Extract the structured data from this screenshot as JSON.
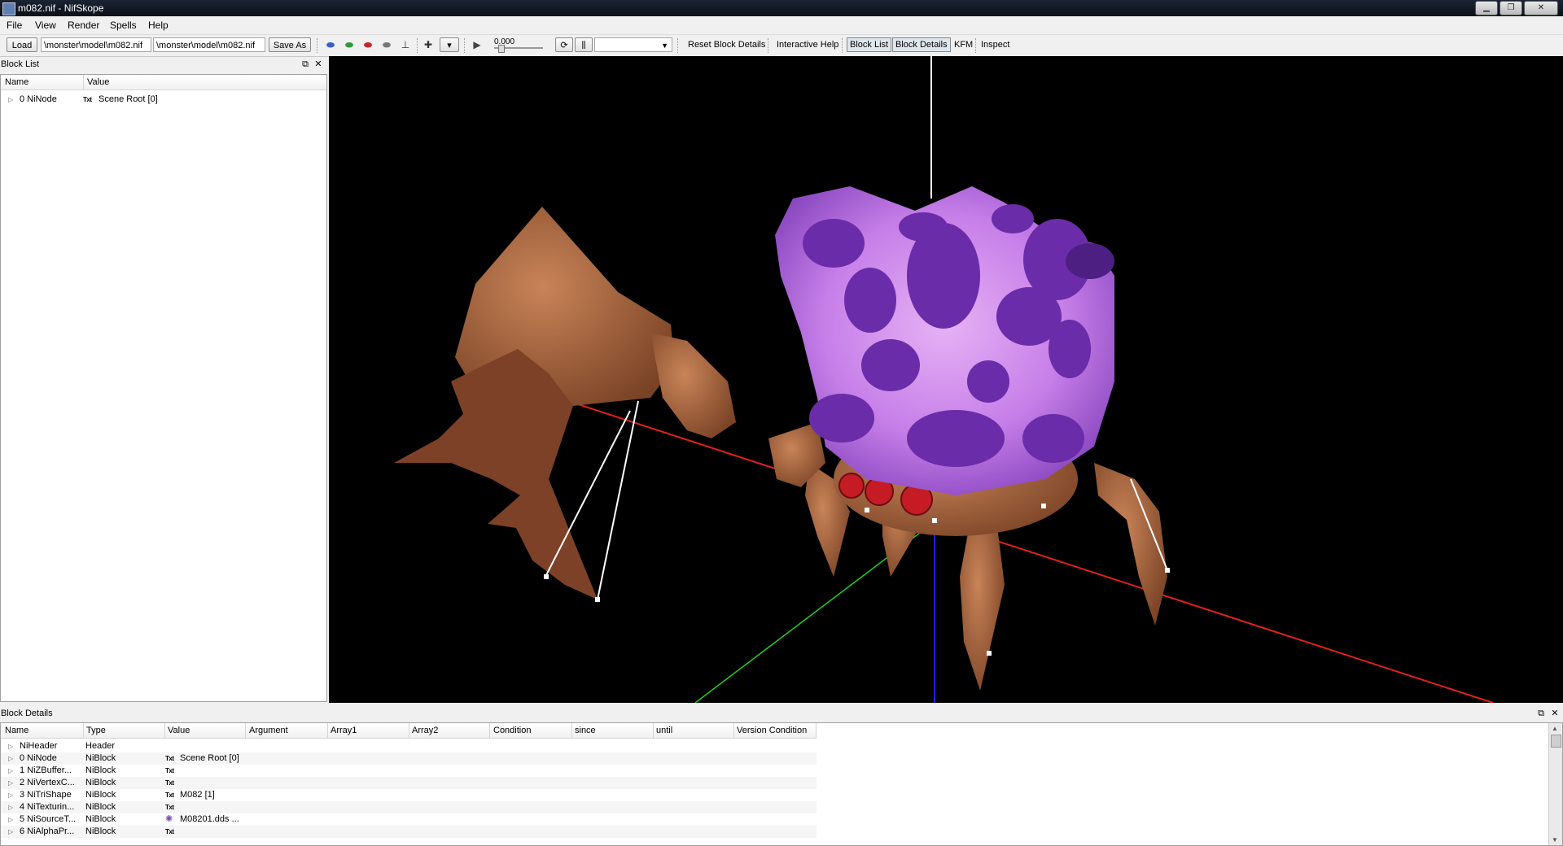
{
  "window": {
    "title": "m082.nif - NifSkope"
  },
  "menu": [
    "File",
    "View",
    "Render",
    "Spells",
    "Help"
  ],
  "toolbar": {
    "load_label": "Load",
    "load_path": "\\monster\\model\\m082.nif",
    "save_path": "\\monster\\model\\m082.nif",
    "save_as_label": "Save As",
    "time_value": "0.000",
    "reset_block_details": "Reset Block Details",
    "interactive_help": "Interactive Help",
    "block_list_toggle": "Block List",
    "block_details_toggle": "Block Details",
    "kfm": "KFM",
    "inspect": "Inspect",
    "anim_select": ""
  },
  "block_list": {
    "title": "Block List",
    "columns": [
      "Name",
      "Value"
    ],
    "rows": [
      {
        "name": "0 NiNode",
        "value": "Scene Root [0]",
        "badge": "Txt"
      }
    ]
  },
  "block_details": {
    "title": "Block Details",
    "columns": [
      "Name",
      "Type",
      "Value",
      "Argument",
      "Array1",
      "Array2",
      "Condition",
      "since",
      "until",
      "Version Condition"
    ],
    "rows": [
      {
        "name": "NiHeader",
        "type": "Header",
        "value": "",
        "badge": ""
      },
      {
        "name": "0 NiNode",
        "type": "NiBlock",
        "value": "Scene Root [0]",
        "badge": "Txt"
      },
      {
        "name": "1 NiZBuffer...",
        "type": "NiBlock",
        "value": "",
        "badge": "Txt"
      },
      {
        "name": "2 NiVertexC...",
        "type": "NiBlock",
        "value": "",
        "badge": "Txt"
      },
      {
        "name": "3 NiTriShape",
        "type": "NiBlock",
        "value": "M082 [1]",
        "badge": "Txt"
      },
      {
        "name": "4 NiTexturin...",
        "type": "NiBlock",
        "value": "",
        "badge": "Txt"
      },
      {
        "name": "5 NiSourceT...",
        "type": "NiBlock",
        "value": "M08201.dds ...",
        "badge": "img"
      },
      {
        "name": "6 NiAlphaPr...",
        "type": "NiBlock",
        "value": "",
        "badge": "Txt"
      }
    ]
  },
  "colors": {
    "viewport_bg": "#000000",
    "axis_x": "#e02020",
    "axis_y": "#20d020",
    "axis_z": "#2020ff",
    "creature_shell": "#c67ee8",
    "creature_spots": "#6a2ca8",
    "creature_body": "#a0603a"
  },
  "icons": [
    "shield-blue-icon",
    "shield-green-icon",
    "shield-red-icon",
    "shield-gray-icon",
    "lamp-icon",
    "axes-icon",
    "view-dropdown-icon",
    "play-icon",
    "loop-icon",
    "bars-icon"
  ]
}
